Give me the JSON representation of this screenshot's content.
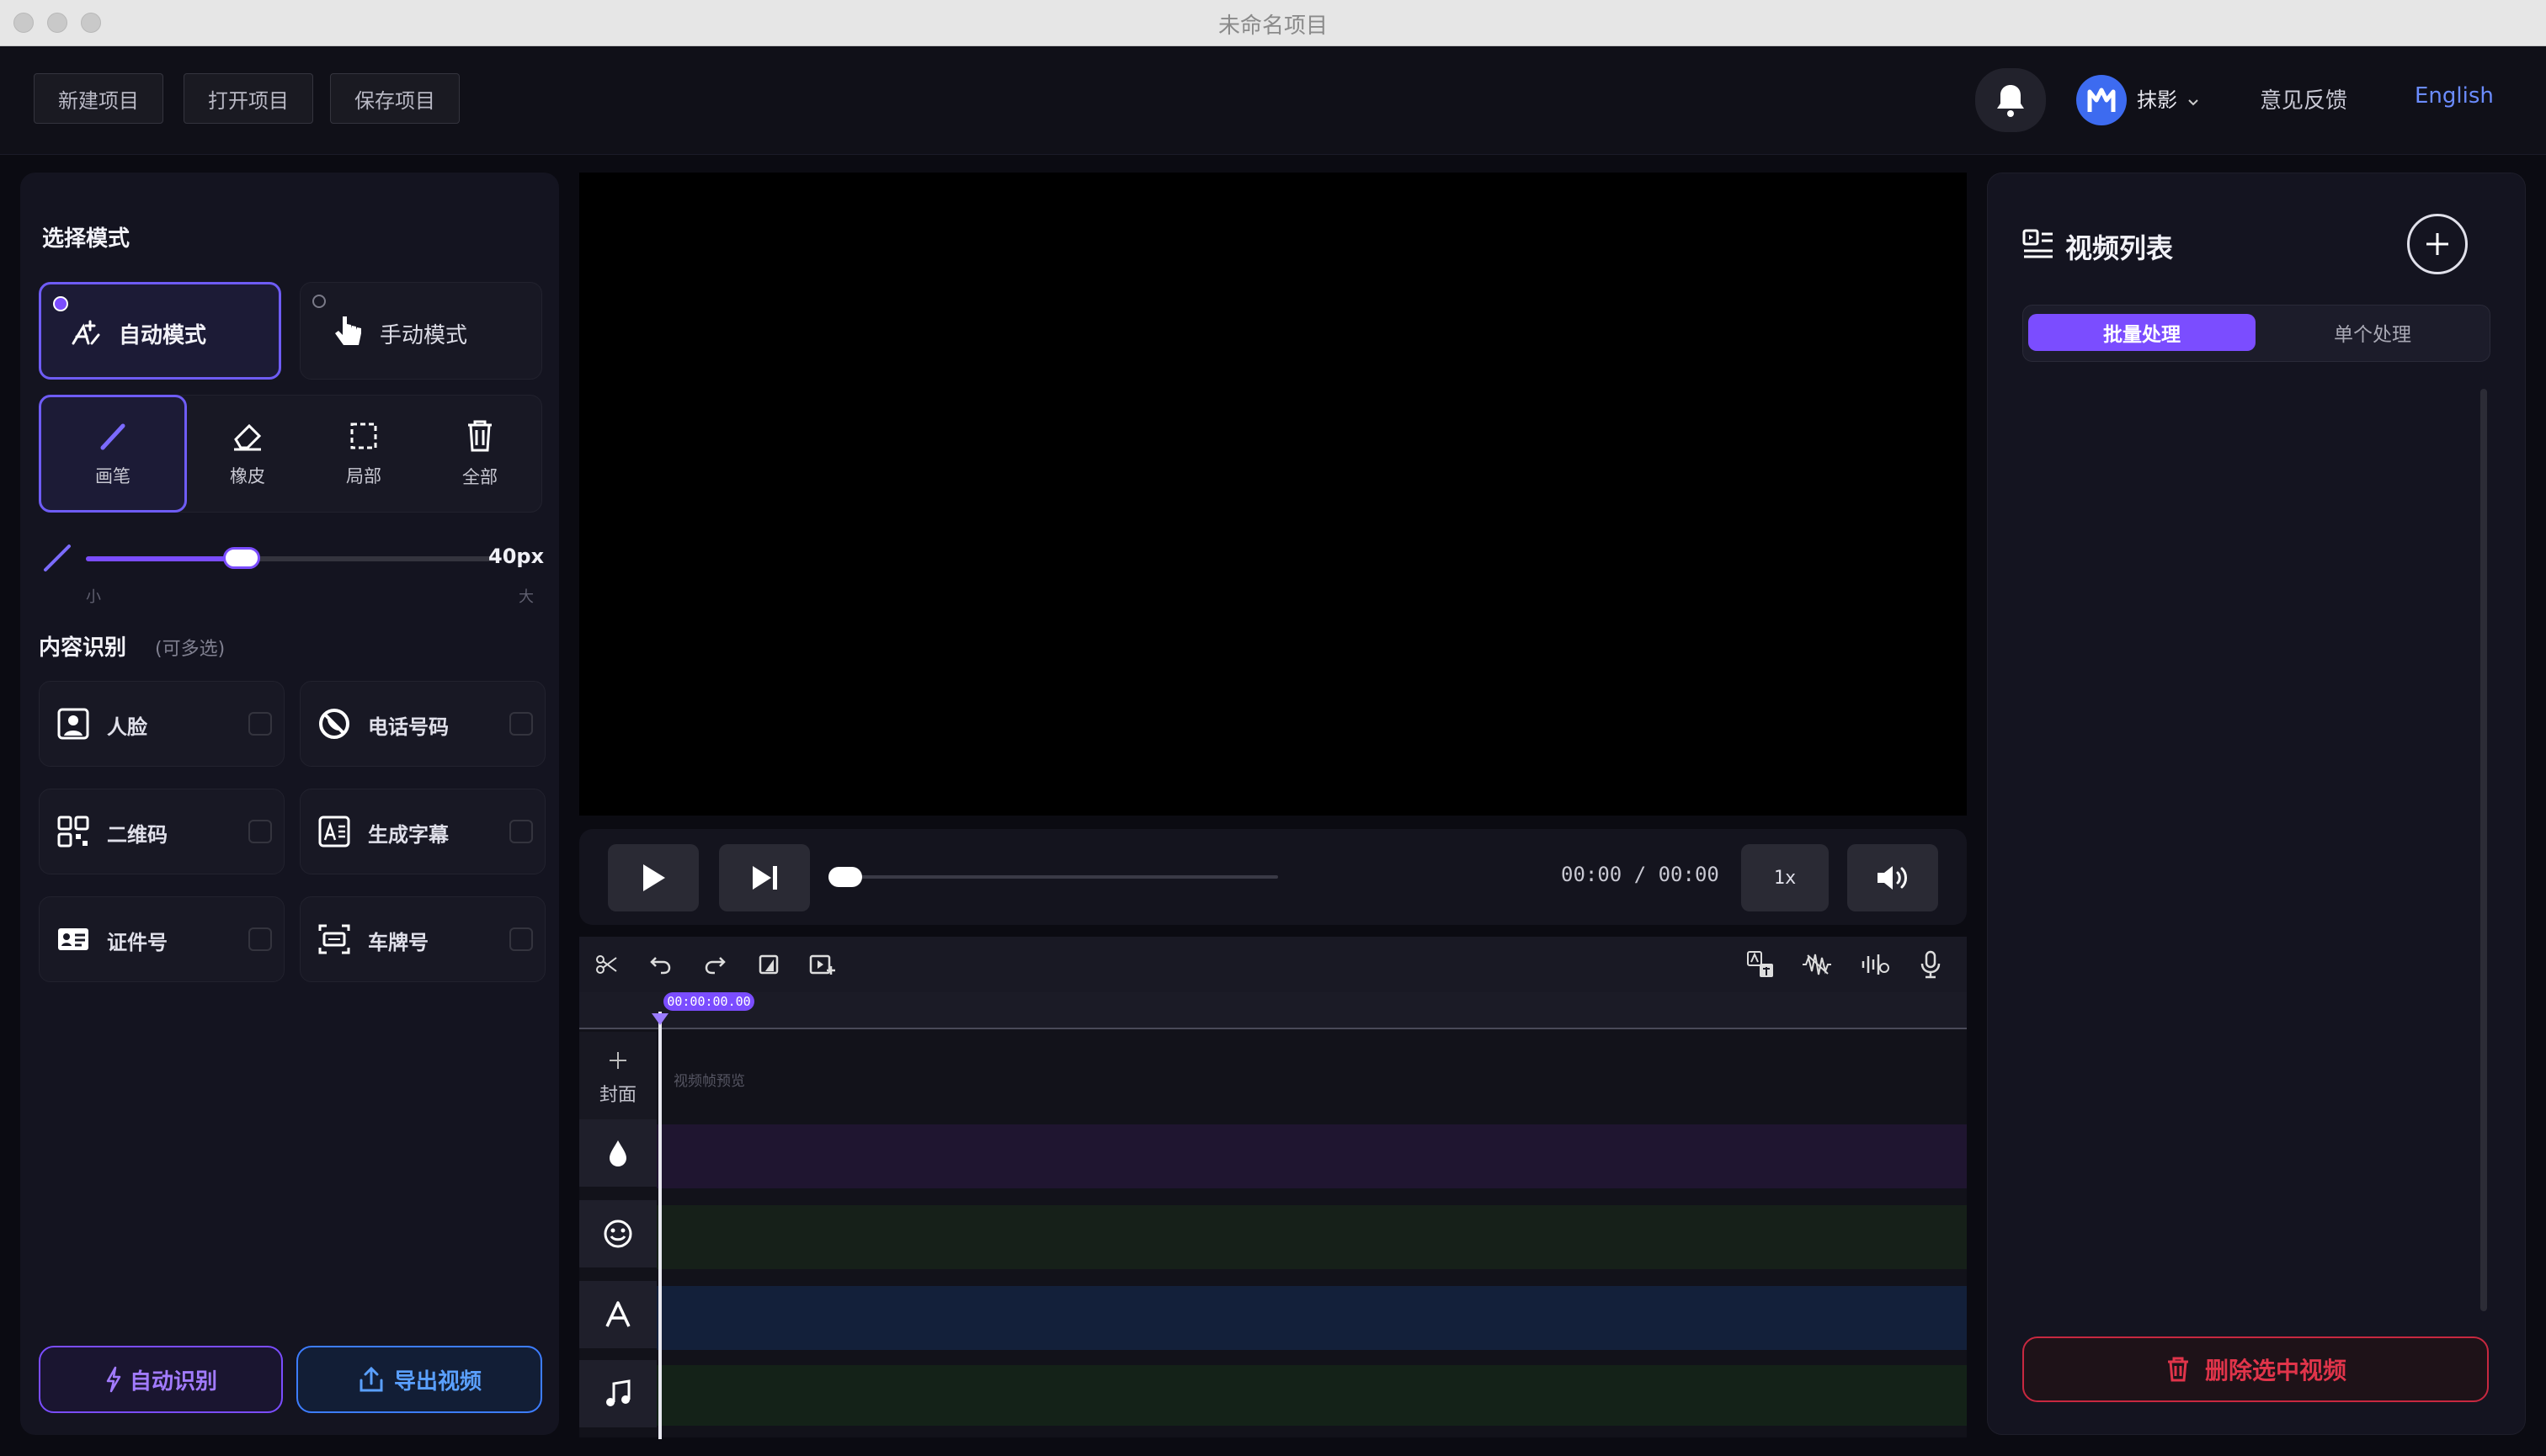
{
  "window": {
    "title": "未命名项目"
  },
  "header": {
    "new_project": "新建项目",
    "open_project": "打开项目",
    "save_project": "保存项目",
    "username": "抹影",
    "feedback": "意见反馈",
    "language": "English"
  },
  "left": {
    "mode_title": "选择模式",
    "auto_mode": "自动模式",
    "manual_mode": "手动模式",
    "tools": {
      "brush": "画笔",
      "eraser": "橡皮",
      "region": "局部",
      "all": "全部"
    },
    "size_value": "40px",
    "size_fraction": 0.38,
    "size_min": "小",
    "size_max": "大",
    "content_title": "内容识别",
    "content_hint": "(可多选)",
    "features": {
      "face": "人脸",
      "phone": "电话号码",
      "qrcode": "二维码",
      "subtitle": "生成字幕",
      "id_card": "证件号",
      "plate": "车牌号"
    },
    "auto_detect": "自动识别",
    "export_video": "导出视频"
  },
  "player": {
    "time": "00:00 / 00:00",
    "speed": "1x"
  },
  "timeline": {
    "playhead_time": "00:00:00.00",
    "cover_label": "封面",
    "frame_preview": "视频帧预览"
  },
  "right": {
    "title": "视频列表",
    "tab_batch": "批量处理",
    "tab_single": "单个处理",
    "delete_selected": "删除选中视频"
  },
  "colors": {
    "accent": "#7b4dff",
    "danger": "#e0344a",
    "export_blue": "#5aa0ff"
  }
}
